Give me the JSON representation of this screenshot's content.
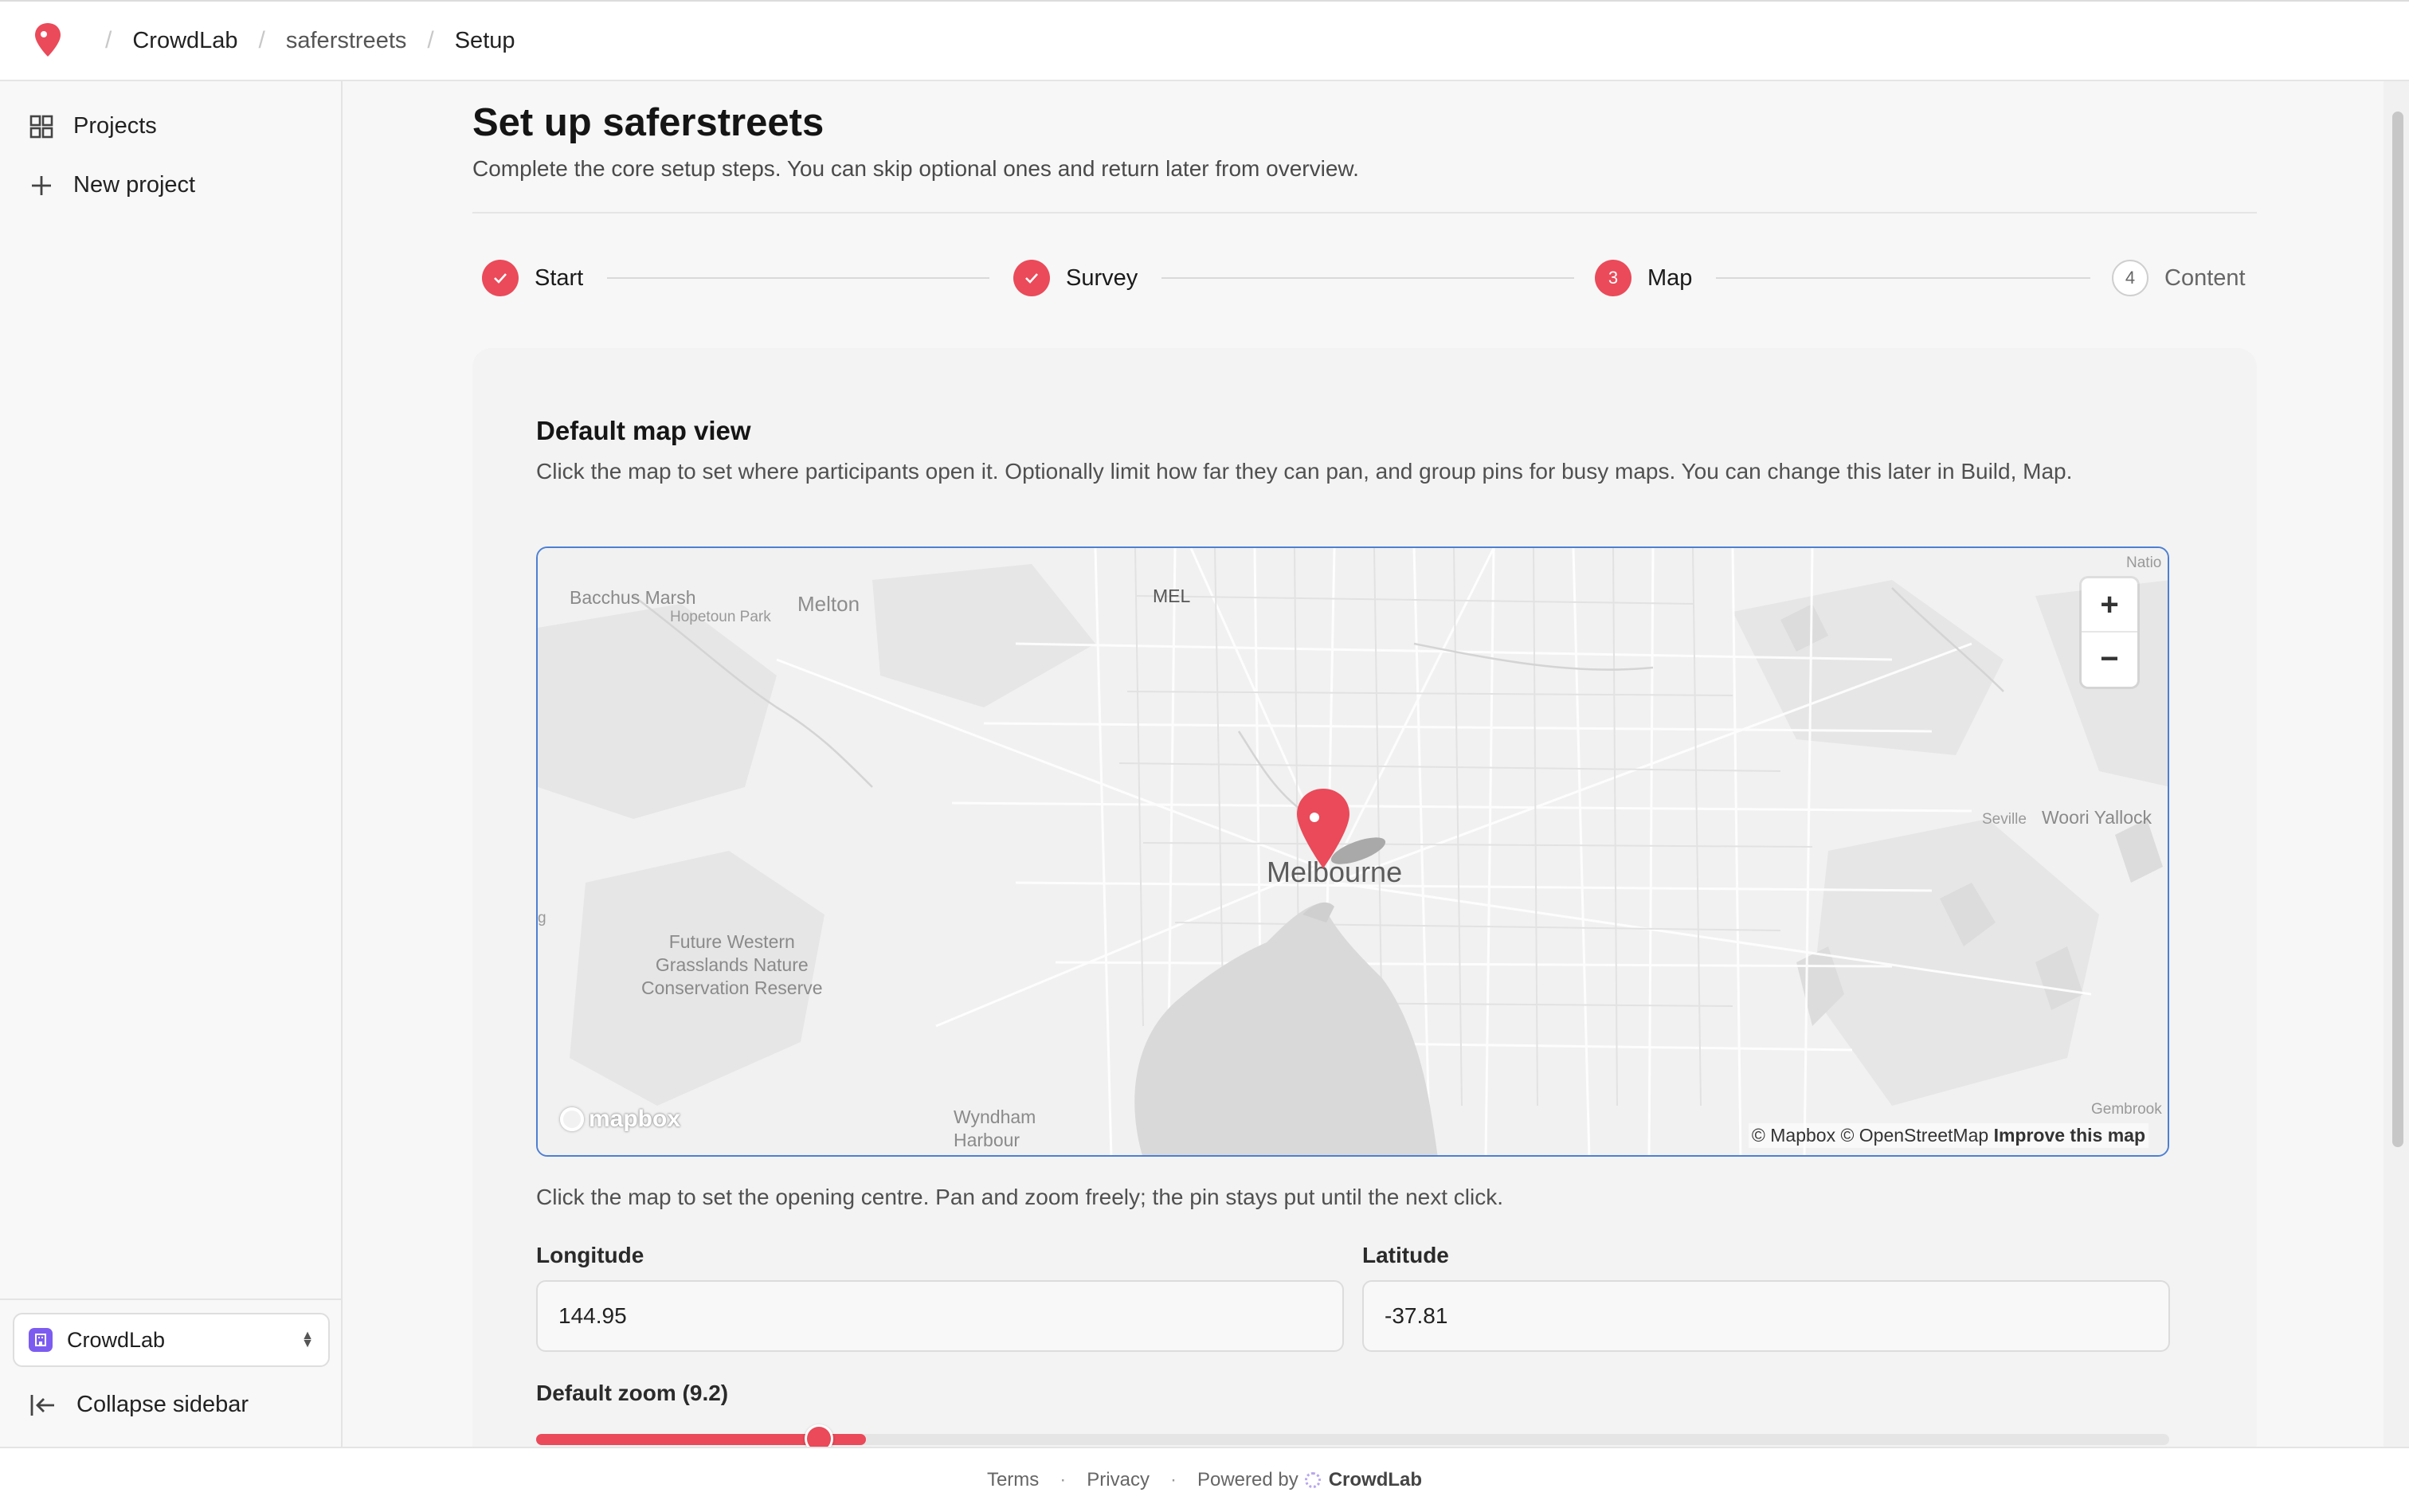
{
  "header": {
    "breadcrumbs": [
      "CrowdLab",
      "saferstreets",
      "Setup"
    ]
  },
  "sidebar": {
    "items": [
      {
        "label": "Projects",
        "icon": "grid-icon"
      },
      {
        "label": "New project",
        "icon": "plus-icon"
      }
    ],
    "org_select": {
      "label": "CrowdLab"
    },
    "collapse_label": "Collapse sidebar"
  },
  "page": {
    "title": "Set up saferstreets",
    "subtitle": "Complete the core setup steps. You can skip optional ones and return later from overview."
  },
  "stepper": {
    "steps": [
      {
        "label": "Start",
        "status": "done",
        "number": ""
      },
      {
        "label": "Survey",
        "status": "done",
        "number": ""
      },
      {
        "label": "Map",
        "status": "current",
        "number": "3"
      },
      {
        "label": "Content",
        "status": "todo",
        "number": "4"
      }
    ]
  },
  "map_section": {
    "title": "Default map view",
    "description": "Click the map to set where participants open it. Optionally limit how far they can pan, and group pins for busy maps. You can change this later in Build, Map.",
    "map": {
      "labels": {
        "city": "Melbourne",
        "melton": "Melton",
        "bacchus": "Bacchus Marsh",
        "hopetoun": "Hopetoun Park",
        "mel": "MEL",
        "seville": "Seville",
        "woori": "Woori Yallock",
        "reserve": "Future Western\nGrasslands Nature\nConservation Reserve",
        "wyndham": "Wyndham\nHarbour",
        "natio": "Natio",
        "gembrook": "Gembrook",
        "edge_g": "g"
      },
      "zoom_in": "+",
      "zoom_out": "−",
      "logo_text": "mapbox",
      "attribution": "© Mapbox © OpenStreetMap",
      "improve_link": "Improve this map"
    },
    "hint": "Click the map to set the opening centre. Pan and zoom freely; the pin stays put until the next click.",
    "longitude": {
      "label": "Longitude",
      "value": "144.95"
    },
    "latitude": {
      "label": "Latitude",
      "value": "-37.81"
    },
    "zoom": {
      "label": "Default zoom (9.2)",
      "value": 9.2
    }
  },
  "footer": {
    "terms": "Terms",
    "privacy": "Privacy",
    "powered_by": "Powered by",
    "brand": "CrowdLab"
  },
  "colors": {
    "accent": "#ea4a59",
    "org_badge": "#7c5cf0"
  }
}
